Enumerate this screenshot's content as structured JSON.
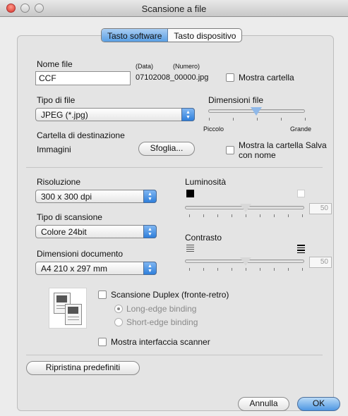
{
  "window": {
    "title": "Scansione a file"
  },
  "tabs": [
    {
      "label": "Tasto software",
      "active": true
    },
    {
      "label": "Tasto dispositivo",
      "active": false
    }
  ],
  "file": {
    "name_label": "Nome file",
    "date_label": "(Data)",
    "number_label": "(Numero)",
    "name_value": "CCF",
    "preview": "07102008_00000.jpg",
    "show_folder_label": "Mostra cartella",
    "show_folder_checked": false
  },
  "file_type": {
    "label": "Tipo di file",
    "value": "JPEG (*.jpg)"
  },
  "file_size": {
    "label": "Dimensioni file",
    "min_label": "Piccolo",
    "max_label": "Grande",
    "level": 0.5
  },
  "destination": {
    "label": "Cartella di destinazione",
    "value": "Immagini",
    "browse_label": "Sfoglia...",
    "save_as_label_line1": "Mostra la cartella Salva",
    "save_as_label_line2": "con nome",
    "save_as_checked": false
  },
  "resolution": {
    "label": "Risoluzione",
    "value": "300 x 300 dpi"
  },
  "scan_type": {
    "label": "Tipo di scansione",
    "value": "Colore 24bit"
  },
  "document_size": {
    "label": "Dimensioni documento",
    "value": "A4  210 x 297 mm"
  },
  "brightness": {
    "label": "Luminosità",
    "value": "50"
  },
  "contrast": {
    "label": "Contrasto",
    "value": "50"
  },
  "duplex": {
    "label": "Scansione Duplex (fronte-retro)",
    "checked": false,
    "long_edge_label": "Long-edge binding",
    "short_edge_label": "Short-edge binding",
    "selected": "long-edge"
  },
  "show_scanner_interface": {
    "label": "Mostra interfaccia scanner",
    "checked": false
  },
  "buttons": {
    "restore": "Ripristina predefiniti",
    "cancel": "Annulla",
    "ok": "OK"
  },
  "colors": {
    "accent": "#5a9fe4",
    "window_bg": "#ececec"
  }
}
